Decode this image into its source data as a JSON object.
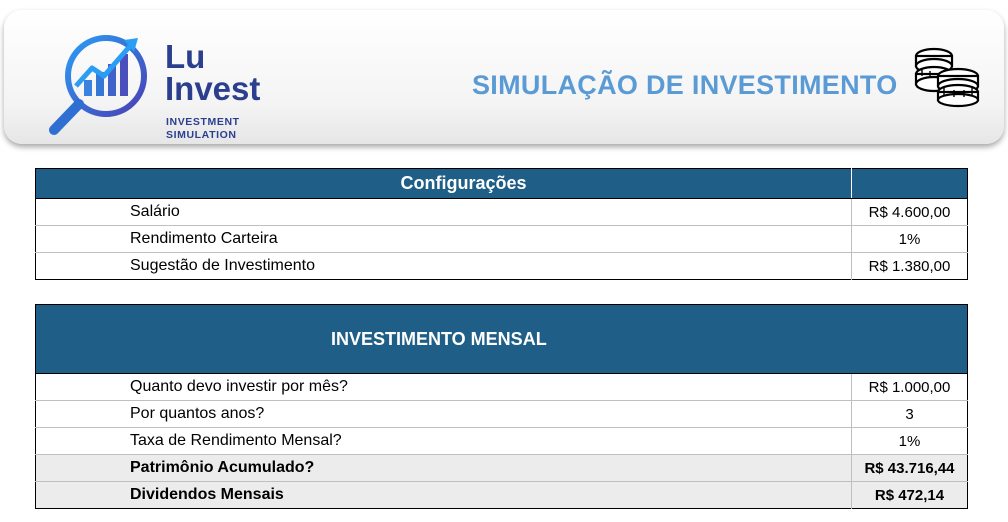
{
  "banner": {
    "logo_line1": "Lu",
    "logo_line2": "Invest",
    "logo_sub1": "INVESTMENT",
    "logo_sub2": "SIMULATION",
    "title": "SIMULAÇÃO DE INVESTIMENTO",
    "accent_color": "#5b9bd5",
    "brand_color": "#2b3f8e",
    "icons": [
      "magnifier-chart-logo-icon",
      "coins-stack-icon"
    ]
  },
  "config": {
    "header": "Configurações",
    "header_color": "#1f5f87",
    "rows": [
      {
        "label": "Salário",
        "value": "R$ 4.600,00"
      },
      {
        "label": "Rendimento Carteira",
        "value": "1%"
      },
      {
        "label": "Sugestão de Investimento",
        "value": "R$ 1.380,00"
      }
    ]
  },
  "monthly": {
    "header": "INVESTIMENTO MENSAL",
    "rows": [
      {
        "label": "Quanto devo investir por mês?",
        "value": "R$ 1.000,00"
      },
      {
        "label": "Por quantos anos?",
        "value": "3"
      },
      {
        "label": "Taxa de Rendimento Mensal?",
        "value": "1%"
      },
      {
        "label": "Patrimônio Acumulado?",
        "value": "R$ 43.716,44"
      },
      {
        "label": "Dividendos Mensais",
        "value": "R$ 472,14"
      }
    ]
  }
}
